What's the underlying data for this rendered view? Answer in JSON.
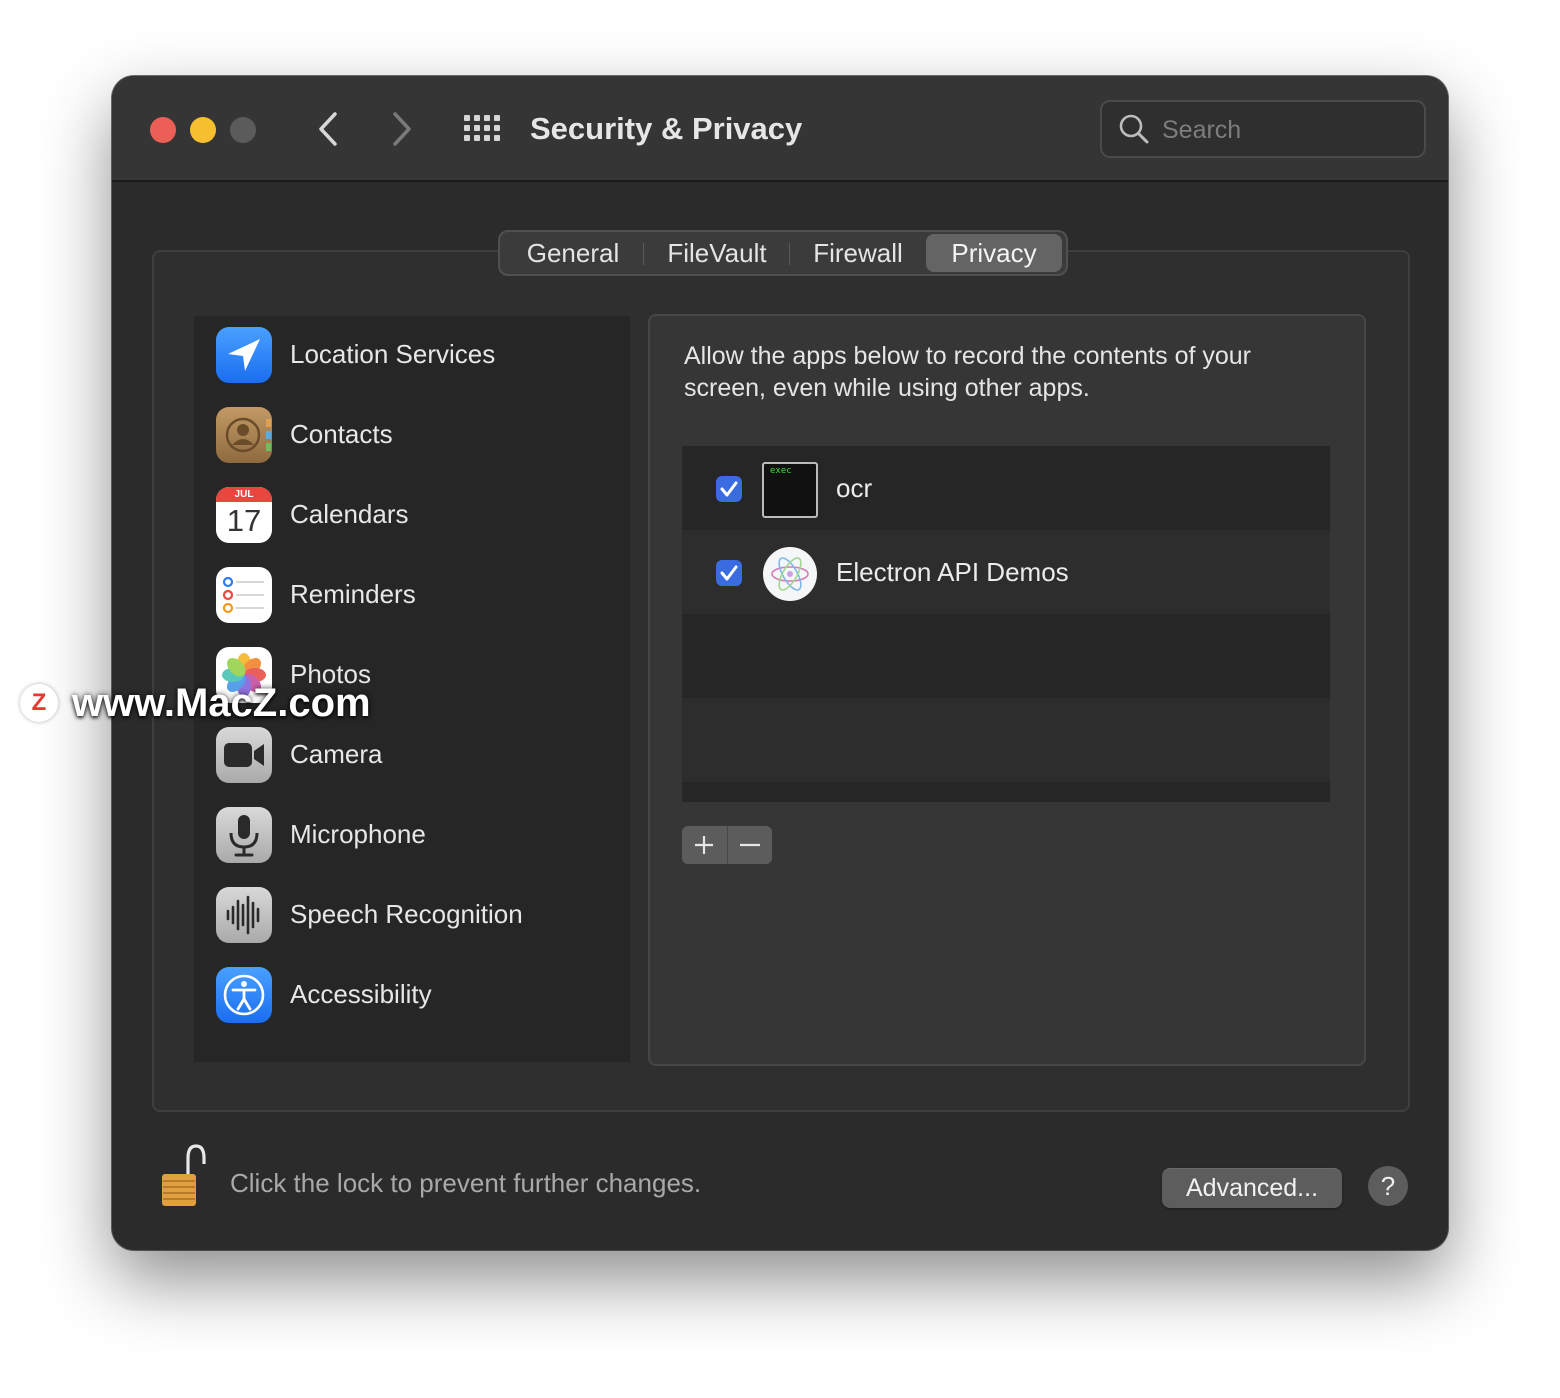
{
  "window": {
    "title": "Security & Privacy",
    "traffic_lights": {
      "close": "#ec5f57",
      "minimize": "#f5bf2f",
      "zoom": "#5b5b5b"
    }
  },
  "search": {
    "placeholder": "Search"
  },
  "tabs": [
    {
      "label": "General",
      "active": false
    },
    {
      "label": "FileVault",
      "active": false
    },
    {
      "label": "Firewall",
      "active": false
    },
    {
      "label": "Privacy",
      "active": true
    }
  ],
  "sidebar": {
    "items": [
      {
        "label": "Location Services",
        "icon": "location-icon"
      },
      {
        "label": "Contacts",
        "icon": "contacts-icon"
      },
      {
        "label": "Calendars",
        "icon": "calendar-icon",
        "month": "JUL",
        "day": "17"
      },
      {
        "label": "Reminders",
        "icon": "reminders-icon"
      },
      {
        "label": "Photos",
        "icon": "photos-icon"
      },
      {
        "label": "Camera",
        "icon": "camera-icon"
      },
      {
        "label": "Microphone",
        "icon": "microphone-icon"
      },
      {
        "label": "Speech Recognition",
        "icon": "speech-recognition-icon"
      },
      {
        "label": "Accessibility",
        "icon": "accessibility-icon"
      }
    ]
  },
  "detail": {
    "description": "Allow the apps below to record the contents of your screen, even while using other apps.",
    "apps": [
      {
        "name": "ocr",
        "checked": true,
        "icon": "terminal-exec-icon",
        "icon_text": "exec"
      },
      {
        "name": "Electron API Demos",
        "checked": true,
        "icon": "electron-icon"
      }
    ]
  },
  "footer": {
    "lock_text": "Click the lock to prevent further changes.",
    "advanced_label": "Advanced...",
    "help_label": "?"
  },
  "watermark": {
    "logo": "Z",
    "text": "www.MacZ.com"
  },
  "colors": {
    "accent": "#3b6be0",
    "window_bg": "#2b2b2b",
    "titlebar_bg": "#353535"
  }
}
